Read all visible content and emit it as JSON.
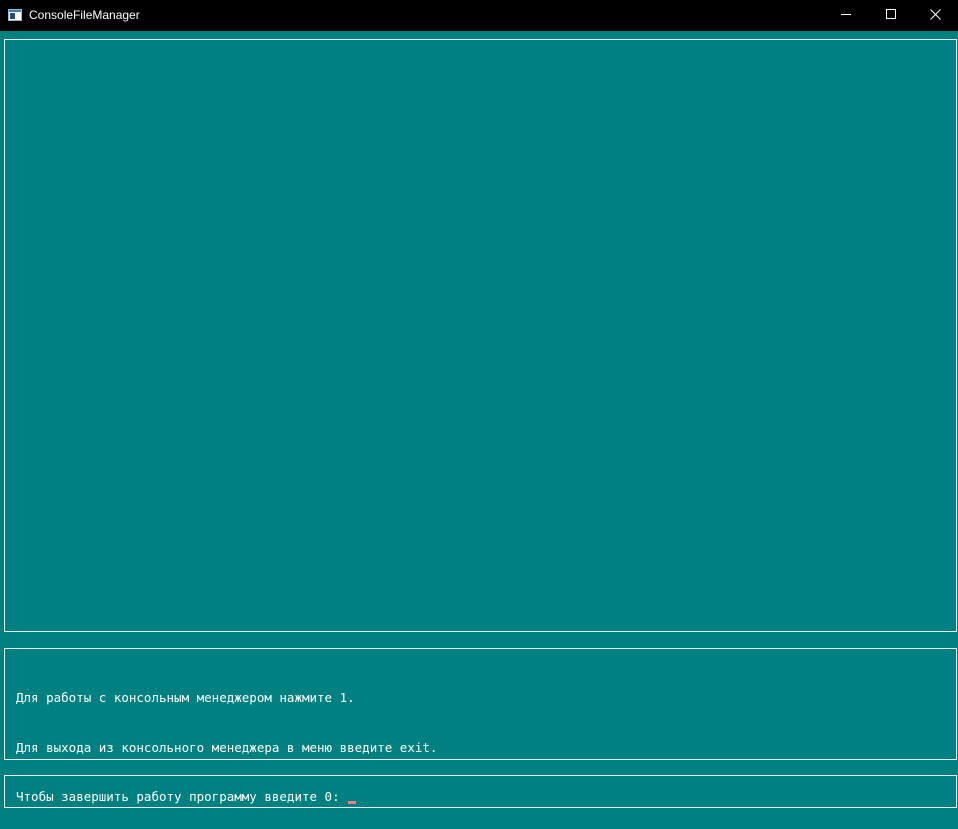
{
  "window": {
    "title": "ConsoleFileManager",
    "icons": {
      "app": "console-window-icon",
      "minimize": "minimize-icon",
      "maximize": "maximize-icon",
      "close": "close-icon"
    }
  },
  "console": {
    "lines": [
      "Для работы с консольным менеджером нажмите 1.",
      "Для выхода из консольного менеджера в меню введите exit.",
      "Чтобы завершить работу программу введите 0: "
    ],
    "cursor_color": "#f08080"
  },
  "colors": {
    "background": "#008080",
    "titlebar": "#000000",
    "border": "#e6f2f2",
    "text": "#ffffff"
  }
}
